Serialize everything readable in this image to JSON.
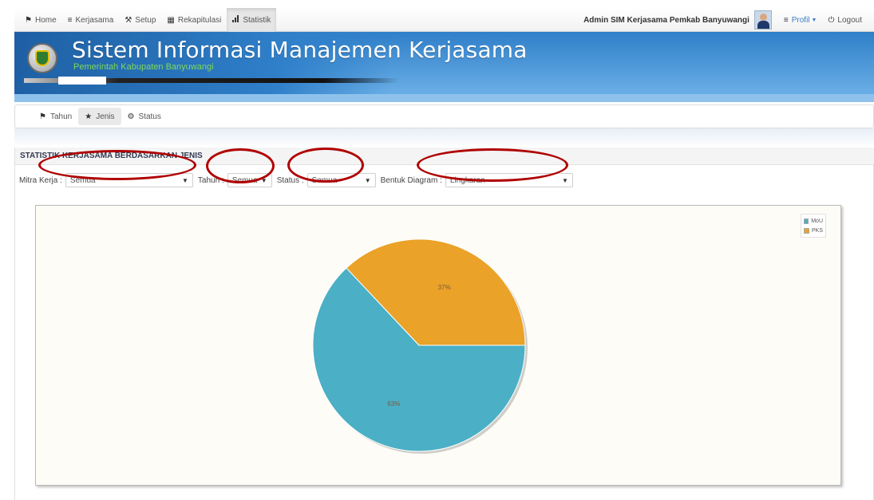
{
  "navbar": {
    "items": [
      {
        "label": "Home",
        "icon": "home-icon"
      },
      {
        "label": "Kerjasama",
        "icon": "list-icon"
      },
      {
        "label": "Setup",
        "icon": "wrench-icon"
      },
      {
        "label": "Rekapitulasi",
        "icon": "table-icon"
      },
      {
        "label": "Statistik",
        "icon": "bar-chart-icon"
      }
    ],
    "active": "Statistik",
    "admin_name": "Admin SIM Kerjasama Pemkab Banyuwangi",
    "profil_label": "Profil",
    "logout_label": "Logout"
  },
  "banner": {
    "title": "Sistem Informasi Manajemen Kerjasama",
    "subtitle": "Pemerintah Kabupaten Banyuwangi"
  },
  "tabs": {
    "items": [
      {
        "label": "Tahun",
        "icon": "bookmark-icon"
      },
      {
        "label": "Jenis",
        "icon": "star-icon"
      },
      {
        "label": "Status",
        "icon": "gear-icon"
      }
    ],
    "active": "Jenis"
  },
  "statistik": {
    "title": "STATISTIK KERJASAMA BERDASARKAN JENIS",
    "filters": {
      "mitra_label": "Mitra Kerja :",
      "mitra_value": "Semua",
      "tahun_label": "Tahun :",
      "tahun_value": "Semua",
      "status_label": "Status :",
      "status_value": "Semua",
      "diagram_label": "Bentuk Diagram :",
      "diagram_value": "Lingkaran"
    }
  },
  "colors": {
    "mou": "#4bafc6",
    "pks": "#eaa228",
    "annotation": "#b00000"
  },
  "chart_data": {
    "type": "pie",
    "categories": [
      "MoU",
      "PKS"
    ],
    "values": [
      63,
      37
    ],
    "labels": [
      "63%",
      "37%"
    ],
    "legend": "top-right"
  }
}
